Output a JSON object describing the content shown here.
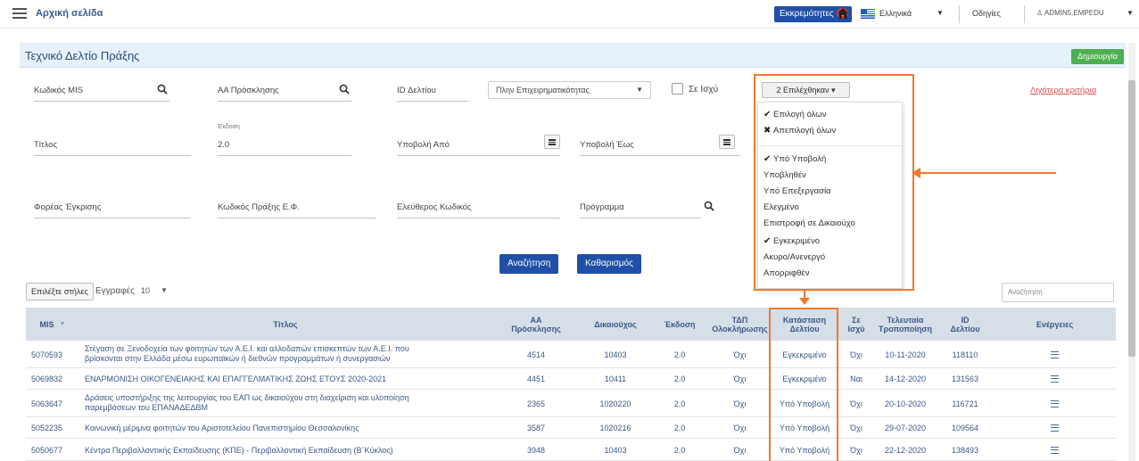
{
  "topbar": {
    "home_label": "Αρχική σελίδα",
    "pending_label": "Εκκρεμότητες",
    "pending_count": "0",
    "language": "Ελληνικά",
    "help": "Οδηγίες",
    "user": "ADMIN5.EMPEDU"
  },
  "page": {
    "title": "Τεχνικό Δελτίο Πράξης",
    "create_button": "Δημιουργία"
  },
  "filters": {
    "mis_code": "Κωδικός MIS",
    "call_number": "ΑΑ Πρόσκλησης",
    "sheet_id": "ID Δελτίου",
    "select_value": "Πλην Επιχειρηματικότητας",
    "in_force": "Σε Ισχύ",
    "status_button": "2 Επιλέχθηκαν",
    "more_criteria": "Λιγότερα κριτήρια",
    "title": "Τίτλος",
    "version_label": "Έκδοση",
    "version_value": "2.0",
    "submit_from": "Υποβολή Από",
    "submit_to": "Υποβολή Έως",
    "approval_body": "Φορέας Έγκρισης",
    "ef_code": "Κωδικός Πράξης Ε.Φ.",
    "free_code": "Ελεύθερος Κωδικός",
    "program": "Πρόγραμμα"
  },
  "status_menu": {
    "select_all": "Επιλογή όλων",
    "deselect_all": "Απεπιλογή όλων",
    "items": [
      {
        "label": "Υπό Υποβολή",
        "checked": true
      },
      {
        "label": "Υποβληθέν",
        "checked": false
      },
      {
        "label": "Υπό Επεξεργασία",
        "checked": false
      },
      {
        "label": "Ελεγμένο",
        "checked": false
      },
      {
        "label": "Επιστροφή σε Δικαιούχο",
        "checked": false
      },
      {
        "label": "Εγκεκριμένο",
        "checked": true
      },
      {
        "label": "Ακυρο/Ανενεργό",
        "checked": false
      },
      {
        "label": "Απορριφθέν",
        "checked": false
      }
    ]
  },
  "actions": {
    "search": "Αναζήτηση",
    "clear": "Καθαρισμός",
    "choose_columns": "Επιλέξτε στήλες",
    "records_label": "Εγγραφές",
    "records_value": "10",
    "search_placeholder": "Αναζήτηση"
  },
  "table": {
    "headers": {
      "mis": "MIS",
      "title": "Τίτλος",
      "call_a": "ΑΑ",
      "call_b": "Πρόσκλησης",
      "beneficiary": "Δικαιούχος",
      "version": "Έκδοση",
      "tdp_a": "ΤΔΠ",
      "tdp_b": "Ολοκλήρωσης",
      "status_a": "Κατάσταση",
      "status_b": "Δελτίου",
      "inforce_a": "Σε",
      "inforce_b": "Ισχύ",
      "last_a": "Τελευταία",
      "last_b": "Τροποποίηση",
      "id_a": "ID",
      "id_b": "Δελτίου",
      "actions": "Ενέργειες"
    },
    "rows": [
      {
        "mis": "5070593",
        "title1": "Στέγαση σε Ξενοδοχεία των φοιτητών των Α.Ε.Ι. και αλλοδαπών επισκεπτών των Α.Ε.Ι. που",
        "title2": "βρίσκονται στην Ελλάδα μέσω ευρωπαϊκών ή διεθνών προγραμμάτων ή συνεργασιών",
        "call": "4514",
        "beneficiary": "10403",
        "version": "2.0",
        "tdp": "Όχι",
        "status": "Εγκεκριμένο",
        "inforce": "Όχι",
        "last": "10-11-2020",
        "id": "118110"
      },
      {
        "mis": "5069832",
        "title1": "ΕΝΑΡΜΟΝΙΣΗ ΟΙΚΟΓΕΝΕΙΑΚΗΣ ΚΑΙ ΕΠΑΓΓΕΛΜΑΤΙΚΗΣ ΖΩΗΣ ΕΤΟΥΣ 2020-2021",
        "title2": "",
        "call": "4451",
        "beneficiary": "10411",
        "version": "2.0",
        "tdp": "Όχι",
        "status": "Εγκεκριμένο",
        "inforce": "Ναι",
        "last": "14-12-2020",
        "id": "131563"
      },
      {
        "mis": "5063647",
        "title1": "Δράσεις υποστήριξης της λειτουργίας του ΕΑΠ ως δικαιούχου στη διαχείριση και υλοποίηση",
        "title2": "παρεμβάσεων του ΕΠΑΝΑΔΕΔΒΜ",
        "call": "2365",
        "beneficiary": "1020220",
        "version": "2.0",
        "tdp": "Όχι",
        "status": "Υπό Υποβολή",
        "inforce": "Όχι",
        "last": "20-10-2020",
        "id": "116721"
      },
      {
        "mis": "5052235",
        "title1": "Κοινωνική μέριμνα φοιτητών του Αριστοτελείου Πανεπιστημίου Θεσσαλονίκης",
        "title2": "",
        "call": "3587",
        "beneficiary": "1020216",
        "version": "2.0",
        "tdp": "Όχι",
        "status": "Υπό Υποβολή",
        "inforce": "Όχι",
        "last": "29-07-2020",
        "id": "109564"
      },
      {
        "mis": "5050677",
        "title1": "Κέντρα Περιβαλλοντικής Εκπαίδευσης (ΚΠΕ) - Περιβαλλοντική Εκπαίδευση (Β΄Κύκλος)",
        "title2": "",
        "call": "3948",
        "beneficiary": "10403",
        "version": "2.0",
        "tdp": "Όχι",
        "status": "Υπό Υποβολή",
        "inforce": "Όχι",
        "last": "22-12-2020",
        "id": "138493"
      }
    ]
  },
  "colors": {
    "accent": "#1f4fa6",
    "highlight": "#f07a2a",
    "create": "#4caf50"
  }
}
